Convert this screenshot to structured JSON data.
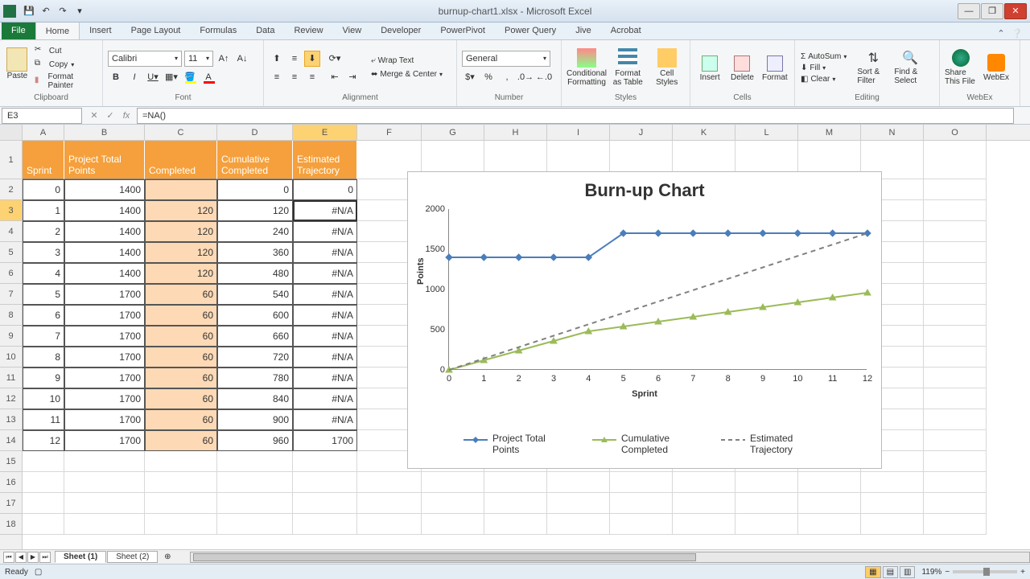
{
  "window": {
    "title": "burnup-chart1.xlsx - Microsoft Excel"
  },
  "tabs": {
    "file": "File",
    "list": [
      "Home",
      "Insert",
      "Page Layout",
      "Formulas",
      "Data",
      "Review",
      "View",
      "Developer",
      "PowerPivot",
      "Power Query",
      "Jive",
      "Acrobat"
    ],
    "active": "Home"
  },
  "ribbon": {
    "clipboard": {
      "label": "Clipboard",
      "paste": "Paste",
      "cut": "Cut",
      "copy": "Copy",
      "painter": "Format Painter"
    },
    "font": {
      "label": "Font",
      "name": "Calibri",
      "size": "11"
    },
    "alignment": {
      "label": "Alignment",
      "wrap": "Wrap Text",
      "merge": "Merge & Center"
    },
    "number": {
      "label": "Number",
      "format": "General"
    },
    "styles": {
      "label": "Styles",
      "cond": "Conditional Formatting",
      "table": "Format as Table",
      "cell": "Cell Styles"
    },
    "cells": {
      "label": "Cells",
      "insert": "Insert",
      "delete": "Delete",
      "format": "Format"
    },
    "editing": {
      "label": "Editing",
      "autosum": "AutoSum",
      "fill": "Fill",
      "clear": "Clear",
      "sort": "Sort & Filter",
      "find": "Find & Select"
    },
    "webex": {
      "label": "WebEx",
      "share": "Share This File",
      "wx": "WebEx"
    }
  },
  "namebox": "E3",
  "formula": "=NA()",
  "columns": [
    "A",
    "B",
    "C",
    "D",
    "E",
    "F",
    "G",
    "H",
    "I",
    "J",
    "K",
    "L",
    "M",
    "N",
    "O"
  ],
  "headers": {
    "A": "Sprint",
    "B": "Project Total Points",
    "C": "Completed",
    "D": "Cumulative Completed",
    "E": "Estimated Trajectory"
  },
  "rows": [
    {
      "n": 2,
      "A": "0",
      "B": "1400",
      "C": "",
      "D": "0",
      "E": "0"
    },
    {
      "n": 3,
      "A": "1",
      "B": "1400",
      "C": "120",
      "D": "120",
      "E": "#N/A"
    },
    {
      "n": 4,
      "A": "2",
      "B": "1400",
      "C": "120",
      "D": "240",
      "E": "#N/A"
    },
    {
      "n": 5,
      "A": "3",
      "B": "1400",
      "C": "120",
      "D": "360",
      "E": "#N/A"
    },
    {
      "n": 6,
      "A": "4",
      "B": "1400",
      "C": "120",
      "D": "480",
      "E": "#N/A"
    },
    {
      "n": 7,
      "A": "5",
      "B": "1700",
      "C": "60",
      "D": "540",
      "E": "#N/A"
    },
    {
      "n": 8,
      "A": "6",
      "B": "1700",
      "C": "60",
      "D": "600",
      "E": "#N/A"
    },
    {
      "n": 9,
      "A": "7",
      "B": "1700",
      "C": "60",
      "D": "660",
      "E": "#N/A"
    },
    {
      "n": 10,
      "A": "8",
      "B": "1700",
      "C": "60",
      "D": "720",
      "E": "#N/A"
    },
    {
      "n": 11,
      "A": "9",
      "B": "1700",
      "C": "60",
      "D": "780",
      "E": "#N/A"
    },
    {
      "n": 12,
      "A": "10",
      "B": "1700",
      "C": "60",
      "D": "840",
      "E": "#N/A"
    },
    {
      "n": 13,
      "A": "11",
      "B": "1700",
      "C": "60",
      "D": "900",
      "E": "#N/A"
    },
    {
      "n": 14,
      "A": "12",
      "B": "1700",
      "C": "60",
      "D": "960",
      "E": "1700"
    }
  ],
  "sheets": {
    "list": [
      "Sheet (1)",
      "Sheet (2)"
    ],
    "active": "Sheet (1)"
  },
  "status": {
    "ready": "Ready",
    "zoom": "119%"
  },
  "chart_data": {
    "type": "line",
    "title": "Burn-up Chart",
    "xlabel": "Sprint",
    "ylabel": "Points",
    "x": [
      0,
      1,
      2,
      3,
      4,
      5,
      6,
      7,
      8,
      9,
      10,
      11,
      12
    ],
    "ylim": [
      0,
      2000
    ],
    "yticks": [
      0,
      500,
      1000,
      1500,
      2000
    ],
    "series": [
      {
        "name": "Project Total Points",
        "color": "#4a7ebb",
        "marker": "diamond",
        "values": [
          1400,
          1400,
          1400,
          1400,
          1400,
          1700,
          1700,
          1700,
          1700,
          1700,
          1700,
          1700,
          1700
        ]
      },
      {
        "name": "Cumulative Completed",
        "color": "#9bbb59",
        "marker": "triangle",
        "values": [
          0,
          120,
          240,
          360,
          480,
          540,
          600,
          660,
          720,
          780,
          840,
          900,
          960
        ]
      },
      {
        "name": "Estimated Trajectory",
        "color": "#808080",
        "dashed": true,
        "marker": "none",
        "values": [
          0,
          141.7,
          283.3,
          425,
          566.7,
          708.3,
          850,
          991.7,
          1133.3,
          1275,
          1416.7,
          1558.3,
          1700
        ]
      }
    ],
    "legend": [
      "Project Total Points",
      "Cumulative Completed",
      "Estimated Trajectory"
    ]
  }
}
